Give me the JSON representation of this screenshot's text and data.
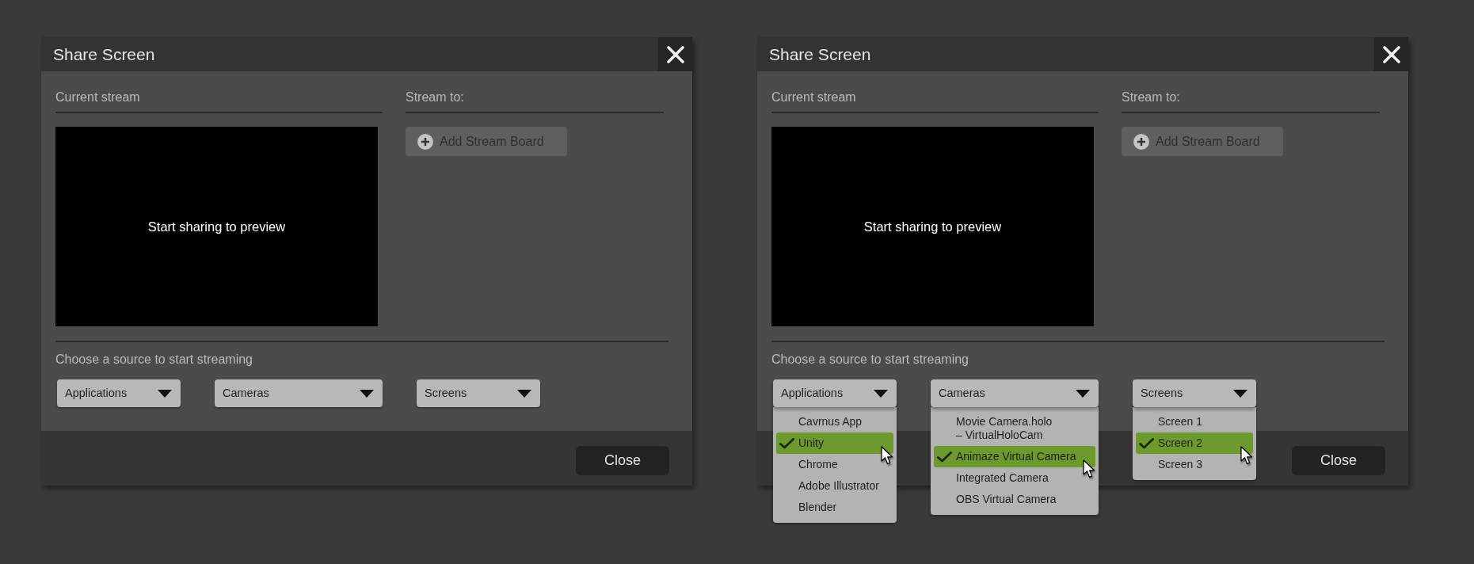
{
  "dialogs": [
    {
      "title": "Share Screen",
      "current_stream": {
        "label": "Current stream",
        "preview_text": "Start sharing to preview"
      },
      "stream_to": {
        "label": "Stream to:",
        "button": "Add Stream Board"
      },
      "source": {
        "label": "Choose a source to start streaming",
        "dropdowns": [
          {
            "label": "Applications",
            "expanded": false
          },
          {
            "label": "Cameras",
            "expanded": false
          },
          {
            "label": "Screens",
            "expanded": false
          }
        ]
      },
      "footer_button": "Close"
    },
    {
      "title": "Share Screen",
      "current_stream": {
        "label": "Current stream",
        "preview_text": "Start sharing to preview"
      },
      "stream_to": {
        "label": "Stream to:",
        "button": "Add Stream Board"
      },
      "source": {
        "label": "Choose a source to start streaming",
        "dropdowns": [
          {
            "label": "Applications",
            "expanded": true,
            "options": [
              {
                "label": "Cavrnus App",
                "selected": false
              },
              {
                "label": "Unity",
                "selected": true
              },
              {
                "label": "Chrome",
                "selected": false
              },
              {
                "label": "Adobe Illustrator",
                "selected": false
              },
              {
                "label": "Blender",
                "selected": false
              }
            ]
          },
          {
            "label": "Cameras",
            "expanded": true,
            "options": [
              {
                "label": "Movie Camera.holo\n– VirtualHoloCam",
                "selected": false
              },
              {
                "label": "Animaze Virtual Camera",
                "selected": true
              },
              {
                "label": "Integrated Camera",
                "selected": false
              },
              {
                "label": "OBS Virtual Camera",
                "selected": false
              }
            ]
          },
          {
            "label": "Screens",
            "expanded": true,
            "options": [
              {
                "label": "Screen 1",
                "selected": false
              },
              {
                "label": "Screen 2",
                "selected": true
              },
              {
                "label": "Screen 3",
                "selected": false
              }
            ]
          }
        ]
      },
      "footer_button": "Close"
    }
  ]
}
